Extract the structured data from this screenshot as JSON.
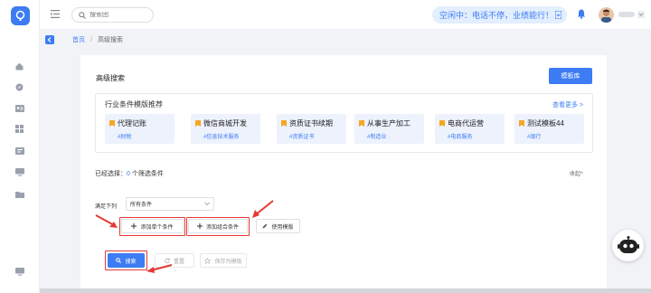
{
  "sidebar": {
    "icons": [
      "home-icon",
      "compass-icon",
      "contact-card-icon",
      "grid-icon",
      "id-card-icon",
      "monitor-icon",
      "folder-icon",
      "settings-monitor-icon"
    ]
  },
  "topbar": {
    "search_placeholder": "搜索团",
    "status_text": "空闲中：电话不停，业绩能行！"
  },
  "breadcrumb": {
    "home": "首页",
    "separator": "/",
    "current": "高级搜索"
  },
  "panel": {
    "title": "高级搜索",
    "template_lib_button": "模板库"
  },
  "recommend": {
    "title": "行业条件模版推荐",
    "see_more": "查看更多 >",
    "cards": [
      {
        "name": "代理记账",
        "tag": "#财税"
      },
      {
        "name": "微信商城开发",
        "tag": "#信息技术服务"
      },
      {
        "name": "资质证书续期",
        "tag": "#资质证书"
      },
      {
        "name": "从事生产加工",
        "tag": "#制造业"
      },
      {
        "name": "电商代运营",
        "tag": "#电商服务"
      },
      {
        "name": "测试模板44",
        "tag": "#银行"
      }
    ]
  },
  "selected": {
    "label": "已经选择：",
    "count": "0",
    "suffix": " 个筛选条件",
    "collapse": "收起^"
  },
  "condition": {
    "satisfy_label": "满足下列",
    "select_value": "所有条件"
  },
  "buttons": {
    "add_single": "添加单个条件",
    "add_group": "添加组合条件",
    "use_template": "使用模版",
    "search": "搜索",
    "reset": "重置",
    "save_template": "保存为模板"
  },
  "colors": {
    "accent": "#3d7cf3",
    "annotation_red": "#e53935",
    "star": "#f6a623"
  }
}
